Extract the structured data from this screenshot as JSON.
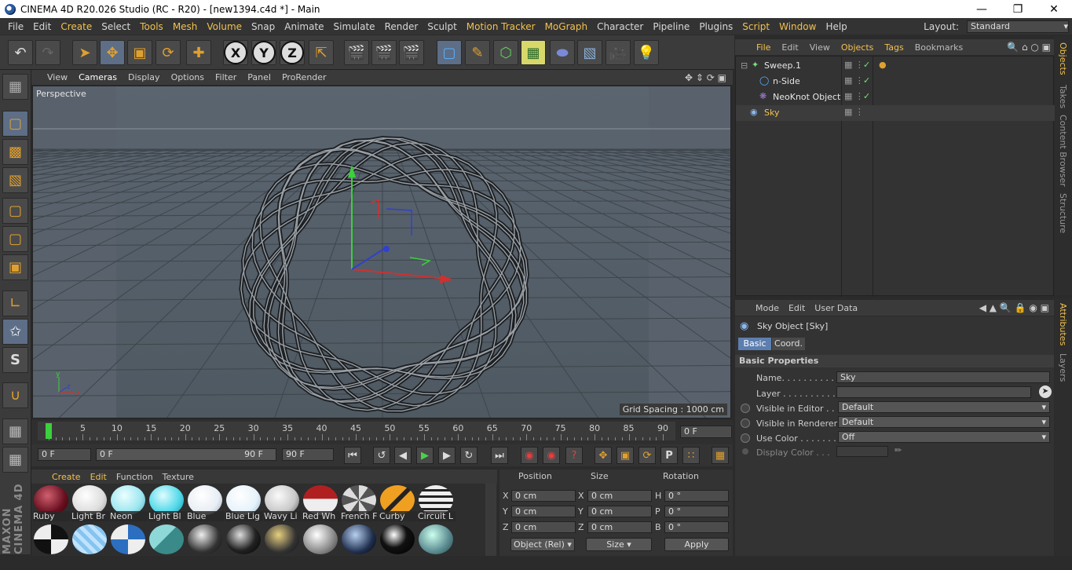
{
  "title": "CINEMA 4D R20.026 Studio (RC - R20) - [new1394.c4d *] - Main",
  "menu": [
    "File",
    "Edit",
    "Create",
    "Select",
    "Tools",
    "Mesh",
    "Volume",
    "Snap",
    "Animate",
    "Simulate",
    "Render",
    "Sculpt",
    "Motion Tracker",
    "MoGraph",
    "Character",
    "Pipeline",
    "Plugins",
    "Script",
    "Window",
    "Help"
  ],
  "menu_highlight": [
    "Create",
    "Tools",
    "Mesh",
    "Volume",
    "Motion Tracker",
    "MoGraph",
    "Script",
    "Window"
  ],
  "layout": {
    "label": "Layout:",
    "value": "Standard"
  },
  "viewport_menu": [
    "View",
    "Cameras",
    "Display",
    "Options",
    "Filter",
    "Panel",
    "ProRender"
  ],
  "viewport": {
    "camera": "Perspective",
    "grid_spacing": "Grid Spacing : 1000 cm"
  },
  "timeline": {
    "ticks": [
      "0",
      "5",
      "10",
      "15",
      "20",
      "25",
      "30",
      "35",
      "40",
      "45",
      "50",
      "55",
      "60",
      "65",
      "70",
      "75",
      "80",
      "85",
      "90"
    ],
    "current_frame": "0 F"
  },
  "transport": {
    "start": "0 F",
    "range_start": "0 F",
    "range_end": "90 F",
    "end": "90 F"
  },
  "material_menu": [
    "Create",
    "Edit",
    "Function",
    "Texture"
  ],
  "materials": [
    "Ruby",
    "Light Br",
    "Neon",
    "Light Bl",
    "Blue",
    "Blue Lig",
    "Wavy Li",
    "Red Wh",
    "French F",
    "Curby",
    "Circuit L"
  ],
  "coords": {
    "headers": [
      "Position",
      "Size",
      "Rotation"
    ],
    "pos": [
      {
        "axis": "X",
        "value": "0 cm"
      },
      {
        "axis": "Y",
        "value": "0 cm"
      },
      {
        "axis": "Z",
        "value": "0 cm"
      }
    ],
    "size": [
      {
        "axis": "X",
        "value": "0 cm"
      },
      {
        "axis": "Y",
        "value": "0 cm"
      },
      {
        "axis": "Z",
        "value": "0 cm"
      }
    ],
    "rot": [
      {
        "axis": "H",
        "value": "0 °"
      },
      {
        "axis": "P",
        "value": "0 °"
      },
      {
        "axis": "B",
        "value": "0 °"
      }
    ],
    "mode": "Object (Rel)",
    "size_mode": "Size",
    "apply": "Apply"
  },
  "objmgr_menu": [
    "File",
    "Edit",
    "View",
    "Objects",
    "Tags",
    "Bookmarks"
  ],
  "objects": [
    {
      "name": "Sweep.1",
      "indent": 0
    },
    {
      "name": "n-Side",
      "indent": 1
    },
    {
      "name": "NeoKnot Object",
      "indent": 1
    },
    {
      "name": "Sky",
      "indent": 0
    }
  ],
  "side_tabs_top": [
    "Objects",
    "Takes",
    "Content Browser",
    "Structure"
  ],
  "side_tabs_bottom": [
    "Attributes",
    "Layers"
  ],
  "attr_menu": [
    "Mode",
    "Edit",
    "User Data"
  ],
  "attr": {
    "object_title": "Sky Object [Sky]",
    "tabs": [
      "Basic",
      "Coord."
    ],
    "section": "Basic Properties",
    "name_label": "Name. . . . . . . . . . . . . .",
    "name_value": "Sky",
    "layer_label": "Layer . . . . . . . . . . . . . .",
    "vis_editor_label": "Visible in Editor . . .",
    "vis_editor_value": "Default",
    "vis_render_label": "Visible in Renderer",
    "vis_render_value": "Default",
    "use_color_label": "Use Color . . . . . . . .",
    "use_color_value": "Off",
    "display_color_label": "Display Color . . ."
  },
  "brand": "MAXON CINEMA 4D"
}
